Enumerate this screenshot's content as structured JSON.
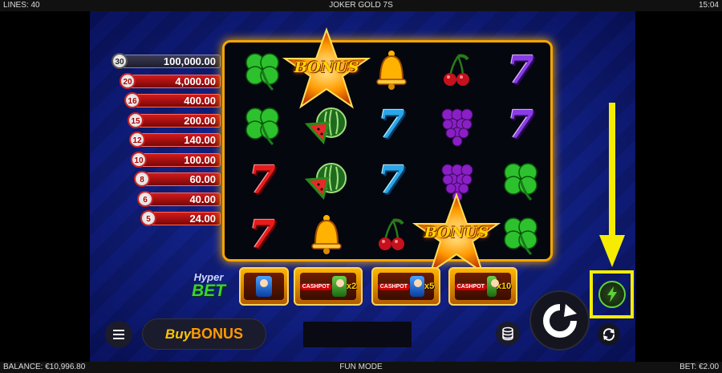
{
  "topbar": {
    "lines": "LINES: 40",
    "title": "JOKER GOLD 7S",
    "time": "15:04"
  },
  "bottombar": {
    "balance": "BALANCE: €10,996.80",
    "mode": "FUN MODE",
    "bet": "BET: €2.00"
  },
  "paytable": [
    {
      "count": "30",
      "value": "100,000.00",
      "tier": "top"
    },
    {
      "count": "20",
      "value": "4,000.00",
      "tier": "red"
    },
    {
      "count": "16",
      "value": "400.00",
      "tier": "red"
    },
    {
      "count": "15",
      "value": "200.00",
      "tier": "red"
    },
    {
      "count": "12",
      "value": "140.00",
      "tier": "red"
    },
    {
      "count": "10",
      "value": "100.00",
      "tier": "red"
    },
    {
      "count": "8",
      "value": "60.00",
      "tier": "red"
    },
    {
      "count": "6",
      "value": "40.00",
      "tier": "red"
    },
    {
      "count": "5",
      "value": "24.00",
      "tier": "red"
    }
  ],
  "reels": [
    [
      "clover",
      "clover",
      "seven-red",
      "seven-red"
    ],
    [
      "bonus",
      "watermelon",
      "watermelon",
      "bell"
    ],
    [
      "bell",
      "seven-blue",
      "seven-blue",
      "cherry"
    ],
    [
      "cherry",
      "grapes",
      "grapes",
      "bonus"
    ],
    [
      "seven-purple",
      "seven-purple",
      "clover",
      "clover"
    ]
  ],
  "bonus_label": "BONUS",
  "hyper_bet": {
    "line1": "Hyper",
    "line2": "BET"
  },
  "bet_tiles": [
    {
      "label": "",
      "multiplier": "",
      "face": "blue"
    },
    {
      "label": "CASHPOT",
      "multiplier": "x2",
      "face": "green"
    },
    {
      "label": "CASHPOT",
      "multiplier": "x5",
      "face": "blue"
    },
    {
      "label": "CASHPOT",
      "multiplier": "x10",
      "face": "green"
    }
  ],
  "buy_bonus": {
    "buy": "Buy",
    "bonus": "BONUS"
  },
  "icons": {
    "menu": "menu-icon",
    "stack": "coin-stack-icon",
    "spin": "spin-icon",
    "autoplay": "autoplay-icon",
    "turbo": "lightning-icon"
  },
  "colors": {
    "highlight": "#f5ec00",
    "reel_frame": "#f5a500",
    "paytable_red": "#d21a1a"
  }
}
